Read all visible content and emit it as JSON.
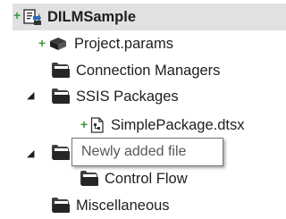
{
  "solution_explorer": {
    "root": {
      "label": "DILMSample",
      "status": "+"
    },
    "items": [
      {
        "label": "Project.params",
        "status": "+"
      },
      {
        "label": "Connection Managers"
      },
      {
        "label": "SSIS Packages",
        "expander": "◢"
      },
      {
        "label": "SimplePackage.dtsx",
        "status": "+"
      },
      {
        "label": "Control Flow"
      },
      {
        "label": "Miscellaneous"
      }
    ],
    "hidden_expander": "◢",
    "tooltip": "Newly added file"
  }
}
